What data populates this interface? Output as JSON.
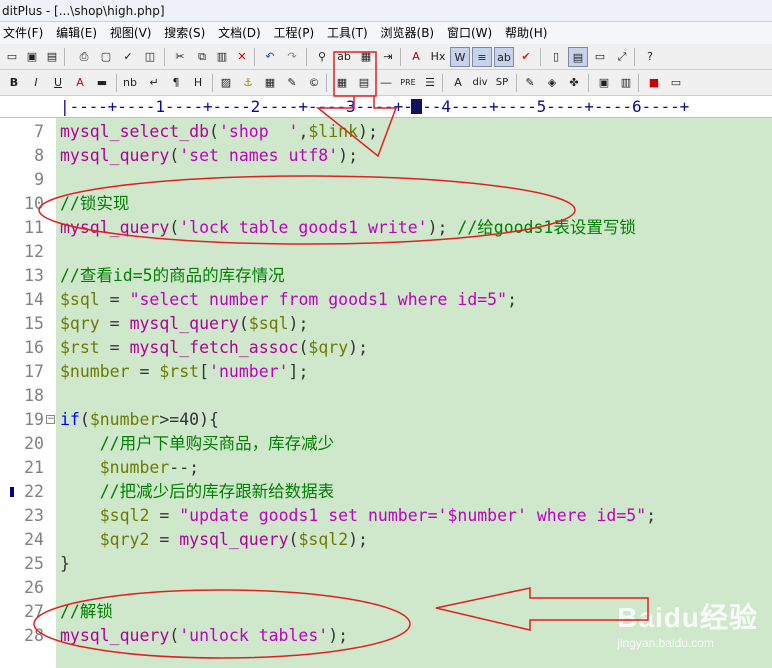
{
  "window": {
    "title": "ditPlus - [...\\shop\\high.php]"
  },
  "menu": [
    {
      "label": "文件(F)"
    },
    {
      "label": "编辑(E)"
    },
    {
      "label": "视图(V)"
    },
    {
      "label": "搜索(S)"
    },
    {
      "label": "文档(D)"
    },
    {
      "label": "工程(P)"
    },
    {
      "label": "工具(T)"
    },
    {
      "label": "浏览器(B)"
    },
    {
      "label": "窗口(W)"
    },
    {
      "label": "帮助(H)"
    }
  ],
  "toolbar_icons": [
    "new-file-icon",
    "open-icon",
    "save-icon",
    "save-all-icon",
    "print-icon",
    "spellcheck-icon",
    "html-preview-icon",
    "cut-icon",
    "copy-icon",
    "paste-icon",
    "delete-icon",
    "undo-icon",
    "redo-icon",
    "find-icon",
    "replace-icon",
    "find-in-files-icon",
    "goto-icon",
    "font-icon",
    "hex-icon",
    "word-wrap-icon",
    "line-numbers-icon",
    "column-icon",
    "check-icon"
  ],
  "toolbar2_labels": [
    "B",
    "I",
    "U",
    "A",
    "nb",
    "¶",
    "H"
  ],
  "ruler": {
    "text": "|----+----1----+----2----+----3----+----4----+----5----+----6----+"
  },
  "editor": {
    "lines": [
      {
        "n": "7",
        "tokens": [
          [
            "fn",
            "mysql_select_db"
          ],
          [
            "op",
            "("
          ],
          [
            "str",
            "'shop  '"
          ],
          [
            "op",
            ","
          ],
          [
            "var",
            "$link"
          ],
          [
            "op",
            ");"
          ]
        ]
      },
      {
        "n": "8",
        "tokens": [
          [
            "fn",
            "mysql_query"
          ],
          [
            "op",
            "("
          ],
          [
            "str",
            "'set names utf8'"
          ],
          [
            "op",
            ");"
          ]
        ]
      },
      {
        "n": "9",
        "tokens": []
      },
      {
        "n": "10",
        "tokens": [
          [
            "cm",
            "//锁实现"
          ]
        ]
      },
      {
        "n": "11",
        "tokens": [
          [
            "fn",
            "mysql_query"
          ],
          [
            "op",
            "("
          ],
          [
            "str",
            "'lock table goods1 write'"
          ],
          [
            "op",
            "); "
          ],
          [
            "cm",
            "//给goods1表设置写锁"
          ]
        ]
      },
      {
        "n": "12",
        "tokens": []
      },
      {
        "n": "13",
        "tokens": [
          [
            "cm",
            "//查看id=5的商品的库存情况"
          ]
        ]
      },
      {
        "n": "14",
        "tokens": [
          [
            "var",
            "$sql"
          ],
          [
            "op",
            " = "
          ],
          [
            "str",
            "\"select number from goods1 where id=5\""
          ],
          [
            "op",
            ";"
          ]
        ]
      },
      {
        "n": "15",
        "tokens": [
          [
            "var",
            "$qry"
          ],
          [
            "op",
            " = "
          ],
          [
            "fn",
            "mysql_query"
          ],
          [
            "op",
            "("
          ],
          [
            "var",
            "$sql"
          ],
          [
            "op",
            ");"
          ]
        ]
      },
      {
        "n": "16",
        "tokens": [
          [
            "var",
            "$rst"
          ],
          [
            "op",
            " = "
          ],
          [
            "fn",
            "mysql_fetch_assoc"
          ],
          [
            "op",
            "("
          ],
          [
            "var",
            "$qry"
          ],
          [
            "op",
            ");"
          ]
        ]
      },
      {
        "n": "17",
        "tokens": [
          [
            "var",
            "$number"
          ],
          [
            "op",
            " = "
          ],
          [
            "var",
            "$rst"
          ],
          [
            "op",
            "["
          ],
          [
            "str",
            "'number'"
          ],
          [
            "op",
            "];"
          ]
        ]
      },
      {
        "n": "18",
        "tokens": []
      },
      {
        "n": "19",
        "tokens": [
          [
            "kw",
            "if"
          ],
          [
            "op",
            "("
          ],
          [
            "var",
            "$number"
          ],
          [
            "op",
            ">=40){"
          ]
        ]
      },
      {
        "n": "20",
        "tokens": [
          [
            "op",
            "    "
          ],
          [
            "cm",
            "//用户下单购买商品，库存减少"
          ]
        ]
      },
      {
        "n": "21",
        "tokens": [
          [
            "op",
            "    "
          ],
          [
            "var",
            "$number"
          ],
          [
            "op",
            "--;"
          ]
        ]
      },
      {
        "n": "22",
        "tokens": [
          [
            "op",
            "    "
          ],
          [
            "cm",
            "//把减少后的库存跟新给数据表"
          ]
        ]
      },
      {
        "n": "23",
        "tokens": [
          [
            "op",
            "    "
          ],
          [
            "var",
            "$sql2"
          ],
          [
            "op",
            " = "
          ],
          [
            "str",
            "\"update goods1 set number='$number' where id=5\""
          ],
          [
            "op",
            ";"
          ]
        ]
      },
      {
        "n": "24",
        "tokens": [
          [
            "op",
            "    "
          ],
          [
            "var",
            "$qry2"
          ],
          [
            "op",
            " = "
          ],
          [
            "fn",
            "mysql_query"
          ],
          [
            "op",
            "("
          ],
          [
            "var",
            "$sql2"
          ],
          [
            "op",
            ");"
          ]
        ]
      },
      {
        "n": "25",
        "tokens": [
          [
            "op",
            "}"
          ]
        ]
      },
      {
        "n": "26",
        "tokens": []
      },
      {
        "n": "27",
        "tokens": [
          [
            "cm",
            "//解锁"
          ]
        ]
      },
      {
        "n": "28",
        "tokens": [
          [
            "fn",
            "mysql_query"
          ],
          [
            "op",
            "("
          ],
          [
            "str",
            "'unlock tables'"
          ],
          [
            "op",
            ");"
          ]
        ]
      }
    ]
  },
  "watermark": {
    "brand": "Baidu经验",
    "url": "jingyan.baidu.com"
  }
}
